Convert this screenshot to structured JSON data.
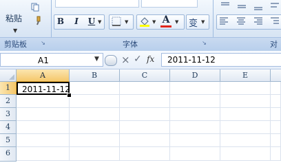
{
  "ribbon": {
    "clipboard": {
      "paste_label": "粘贴",
      "group_label": "剪贴板"
    },
    "font": {
      "group_label": "字体",
      "bold_label": "B",
      "italic_label": "I",
      "underline_label": "U",
      "font_color_letter": "A",
      "phonetic_label": "变"
    },
    "alignment": {
      "group_label_partial": "对"
    }
  },
  "formula_bar": {
    "name_box_value": "A1",
    "cancel_icon": "×",
    "enter_icon": "✓",
    "fx_label": "fx",
    "formula_value": "2011-11-12"
  },
  "sheet": {
    "columns": [
      "A",
      "B",
      "C",
      "D",
      "E"
    ],
    "rows": [
      "1",
      "2",
      "3",
      "4",
      "5",
      "6"
    ],
    "cells": {
      "A1": "2011-11-12"
    },
    "active_cell": "A1"
  },
  "colors": {
    "accent_selected": "#f5c76b",
    "font_color_red": "#e0261b",
    "highlight_yellow": "#ffff00"
  }
}
